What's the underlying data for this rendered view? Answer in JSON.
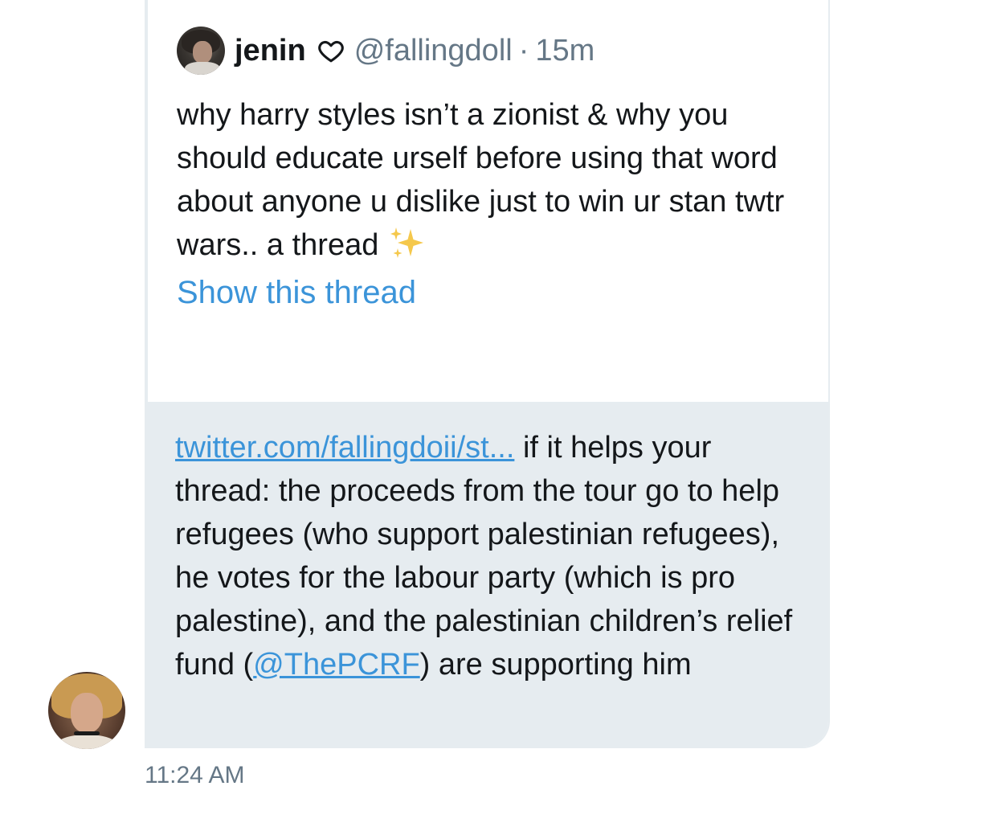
{
  "quoted_tweet": {
    "display_name": "jenin",
    "handle": "@fallingdoll",
    "separator": "·",
    "time_ago": "15m",
    "text": "why harry styles isn’t a zionist & why you should educate urself before using that word about anyone u dislike just to win ur stan twtr wars.. a thread",
    "show_thread_label": "Show this thread"
  },
  "message": {
    "link_text": "twitter.com/fallingdoii/st...",
    "text_part1": " if it helps your thread: the proceeds from the tour go to help refugees (who support palestinian refugees), he votes for the labour party (which is pro palestine), and the palestinian children’s relief fund (",
    "mention": "@ThePCRF",
    "text_part2": ") are supporting him",
    "timestamp": "11:24 AM"
  },
  "colors": {
    "accent": "#3b94d9",
    "secondary_text": "#657786",
    "bubble_bg": "#e6ecf0",
    "border": "#e6ecf0"
  },
  "icons": {
    "heart": "heart-outline-icon",
    "sparkles": "sparkles-icon"
  }
}
